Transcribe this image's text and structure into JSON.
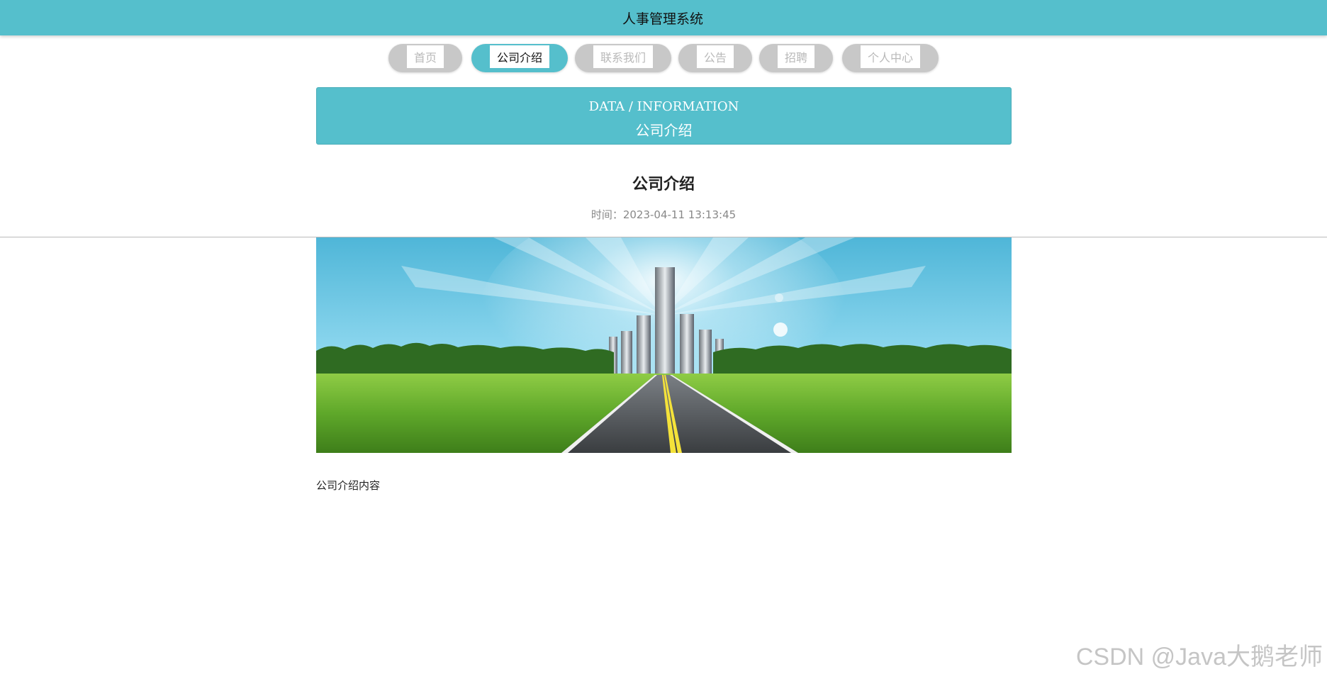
{
  "app": {
    "title": "人事管理系统"
  },
  "nav": {
    "items": [
      {
        "label": "首页",
        "active": false
      },
      {
        "label": "公司介绍",
        "active": true
      },
      {
        "label": "联系我们",
        "active": false
      },
      {
        "label": "公告",
        "active": false
      },
      {
        "label": "招聘",
        "active": false
      },
      {
        "label": "个人中心",
        "active": false
      }
    ]
  },
  "banner": {
    "en": "DATA / INFORMATION",
    "cn": "公司介绍"
  },
  "article": {
    "title": "公司介绍",
    "time": "时间：2023-04-11 13:13:45",
    "content": "公司介绍内容"
  },
  "watermark": "CSDN @Java大鹅老师",
  "colors": {
    "accent": "#55bfcc",
    "pill_inactive": "#c8c8c8"
  }
}
